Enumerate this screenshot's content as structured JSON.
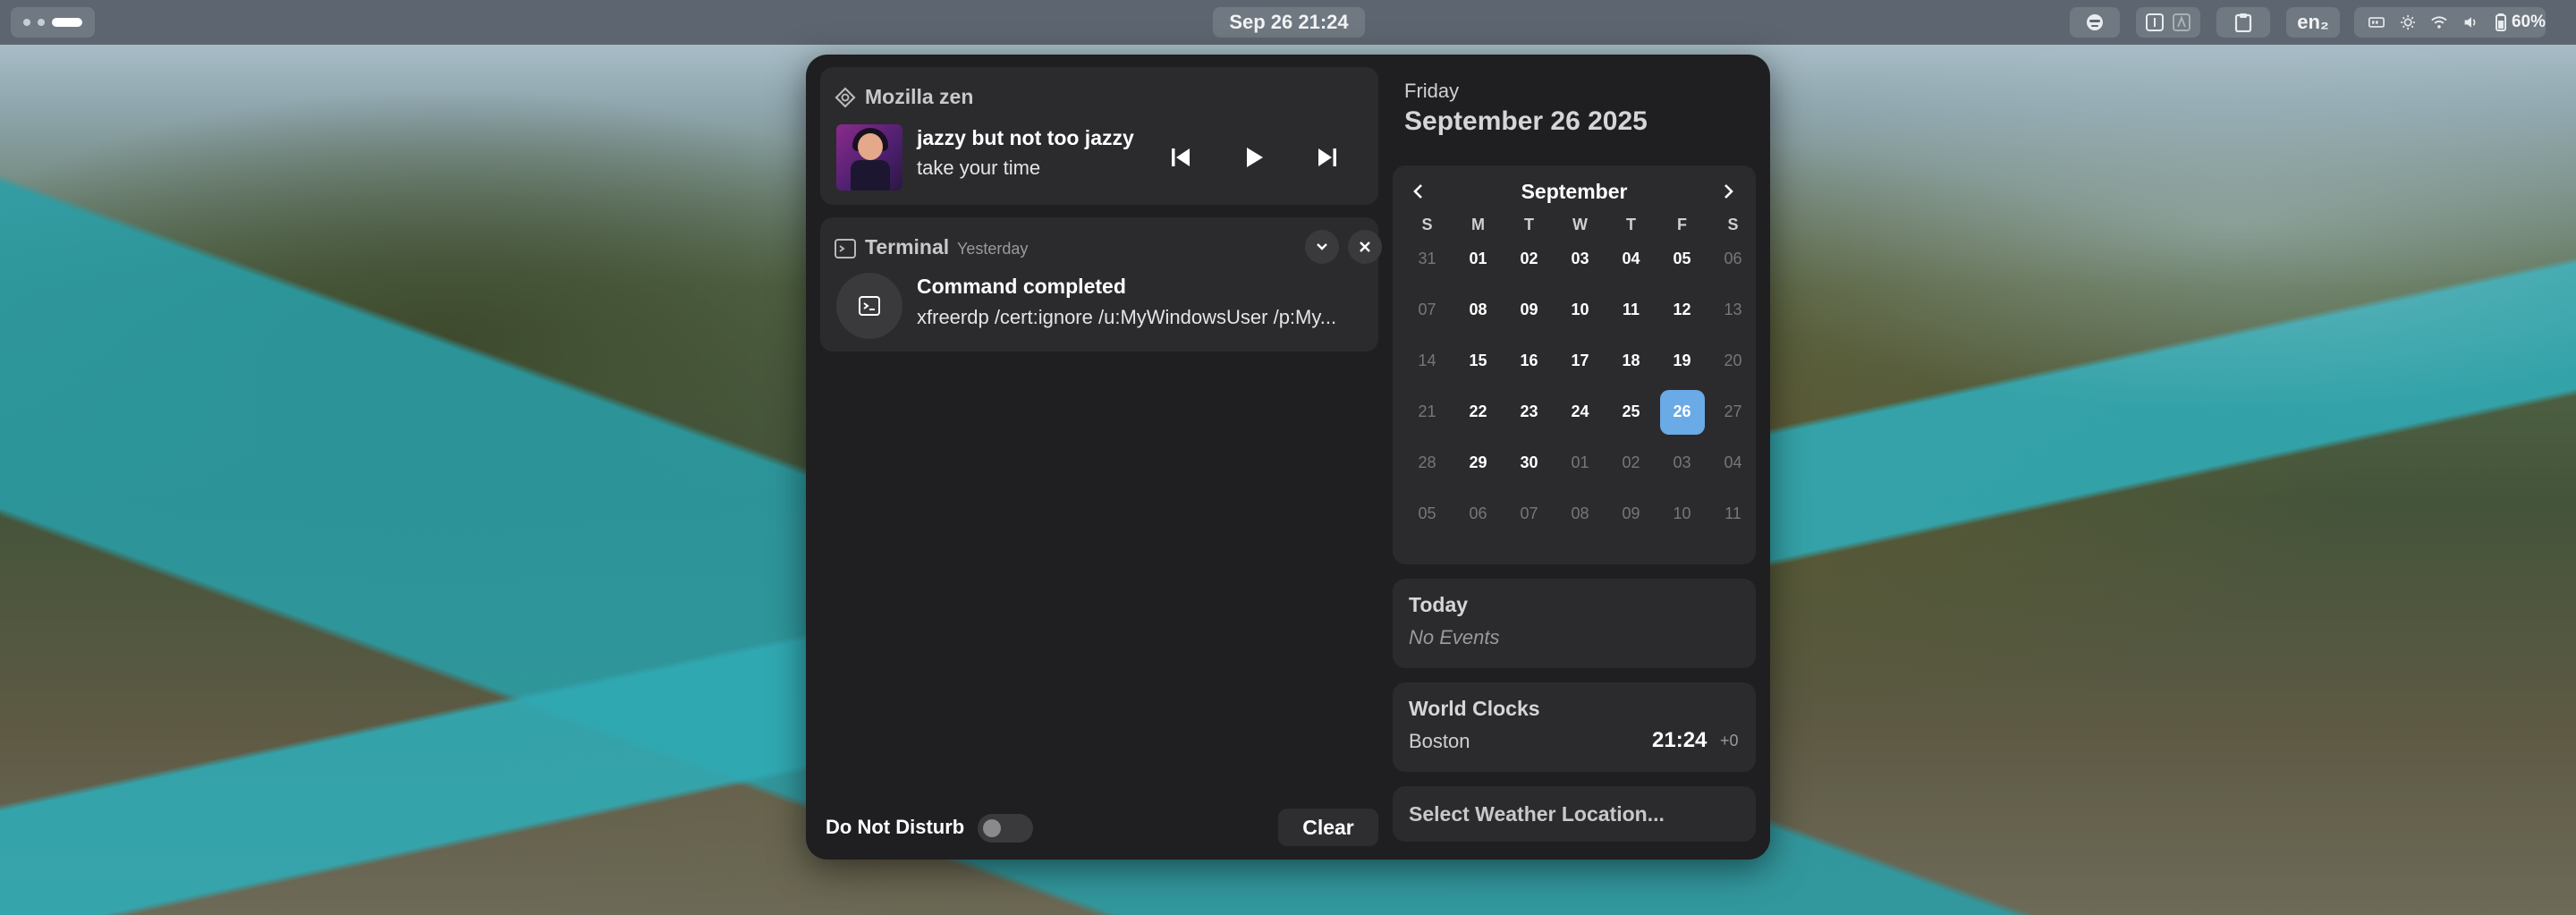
{
  "topbar": {
    "clock_label": "Sep 26  21:24",
    "lang_label": "en₂",
    "battery_label": "60%",
    "icons": [
      "workspaces",
      "emoji-icon",
      "ws-1",
      "ws-2",
      "clipboard-icon",
      "memory-icon",
      "brightness-icon",
      "wifi-icon",
      "volume-icon",
      "battery-icon"
    ]
  },
  "media": {
    "app_name": "Mozilla zen",
    "title": "jazzy but not too jazzy",
    "subtitle": "take your time"
  },
  "notification": {
    "app_name": "Terminal",
    "time": "Yesterday",
    "title": "Command completed",
    "body": "xfreerdp /cert:ignore /u:MyWindowsUser /p:My..."
  },
  "footer": {
    "dnd_label": "Do Not Disturb",
    "clear_label": "Clear"
  },
  "date": {
    "weekday": "Friday",
    "full": "September 26 2025"
  },
  "calendar": {
    "month": "September",
    "weekdays": [
      "S",
      "M",
      "T",
      "W",
      "T",
      "F",
      "S"
    ],
    "weeks": [
      [
        {
          "d": "31",
          "o": true
        },
        {
          "d": "01"
        },
        {
          "d": "02"
        },
        {
          "d": "03"
        },
        {
          "d": "04"
        },
        {
          "d": "05"
        },
        {
          "d": "06",
          "o": true
        }
      ],
      [
        {
          "d": "07",
          "o": true
        },
        {
          "d": "08"
        },
        {
          "d": "09"
        },
        {
          "d": "10"
        },
        {
          "d": "11"
        },
        {
          "d": "12"
        },
        {
          "d": "13",
          "o": true
        }
      ],
      [
        {
          "d": "14",
          "o": true
        },
        {
          "d": "15"
        },
        {
          "d": "16"
        },
        {
          "d": "17"
        },
        {
          "d": "18"
        },
        {
          "d": "19"
        },
        {
          "d": "20",
          "o": true
        }
      ],
      [
        {
          "d": "21",
          "o": true
        },
        {
          "d": "22"
        },
        {
          "d": "23"
        },
        {
          "d": "24"
        },
        {
          "d": "25"
        },
        {
          "d": "26",
          "t": true
        },
        {
          "d": "27",
          "o": true
        }
      ],
      [
        {
          "d": "28",
          "o": true
        },
        {
          "d": "29"
        },
        {
          "d": "30"
        },
        {
          "d": "01",
          "o": true
        },
        {
          "d": "02",
          "o": true
        },
        {
          "d": "03",
          "o": true
        },
        {
          "d": "04",
          "o": true
        }
      ],
      [
        {
          "d": "05",
          "o": true
        },
        {
          "d": "06",
          "o": true
        },
        {
          "d": "07",
          "o": true
        },
        {
          "d": "08",
          "o": true
        },
        {
          "d": "09",
          "o": true
        },
        {
          "d": "10",
          "o": true
        },
        {
          "d": "11",
          "o": true
        }
      ]
    ]
  },
  "events": {
    "title": "Today",
    "empty": "No Events"
  },
  "world_clocks": {
    "title": "World Clocks",
    "city": "Boston",
    "time": "21:24",
    "offset": "+0"
  },
  "weather": {
    "label": "Select Weather Location..."
  },
  "colors": {
    "accent": "#6aaae6",
    "panel": "#1f1f21",
    "card": "#2b2b2d"
  }
}
